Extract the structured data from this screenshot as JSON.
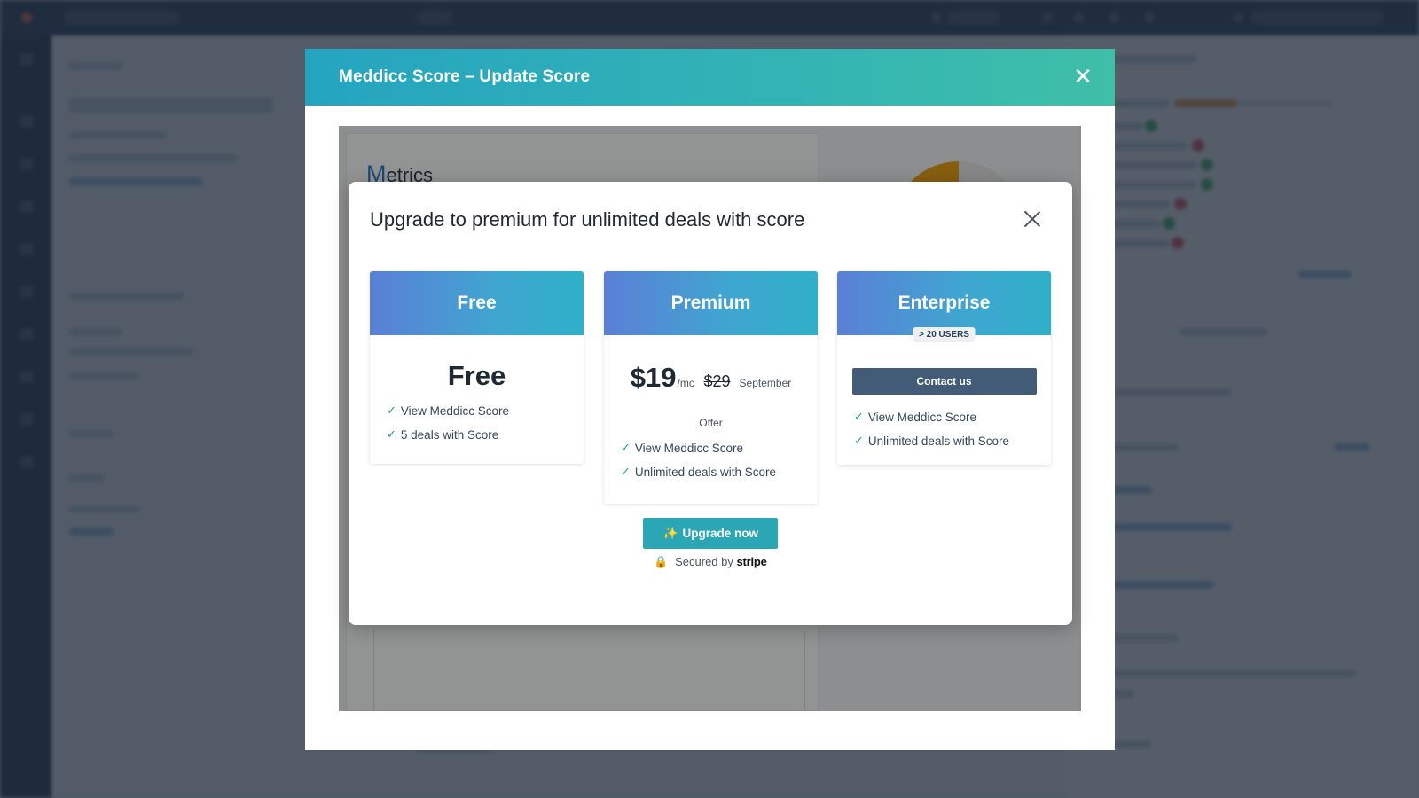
{
  "outer_modal": {
    "title": "Meddicc Score – Update Score",
    "close_glyph": "✕"
  },
  "score_area": {
    "metrics_first_letter": "M",
    "metrics_rest": "etrics"
  },
  "upgrade_modal": {
    "title": "Upgrade to premium for unlimited deals with score",
    "plans": [
      {
        "name": "Free",
        "price": "Free",
        "features": [
          "View Meddicc Score",
          "5 deals with Score"
        ]
      },
      {
        "name": "Premium",
        "price": "$19",
        "per": "/mo",
        "old_price": "$29",
        "offer": "September",
        "offer_line2": "Offer",
        "features": [
          "View Meddicc Score",
          "Unlimited deals with Score"
        ]
      },
      {
        "name": "Enterprise",
        "badge": "> 20 USERS",
        "cta": "Contact us",
        "features": [
          "View Meddicc Score",
          "Unlimited deals with Score"
        ]
      }
    ],
    "check_glyph": "✓",
    "upgrade_button": "Upgrade now",
    "upgrade_icon": "✨",
    "secured_icon": "🔒",
    "secured_by": "Secured by",
    "secured_brand": "stripe"
  },
  "colors": {
    "header_gradient_start": "#25a4c0",
    "header_gradient_end": "#3fbfa8",
    "plan_header_start": "#5b7fd6",
    "plan_header_end": "#2fb0c8",
    "upgrade_button": "#2aa6b4",
    "contact_button": "#425b76",
    "check": "#1f9e89"
  }
}
